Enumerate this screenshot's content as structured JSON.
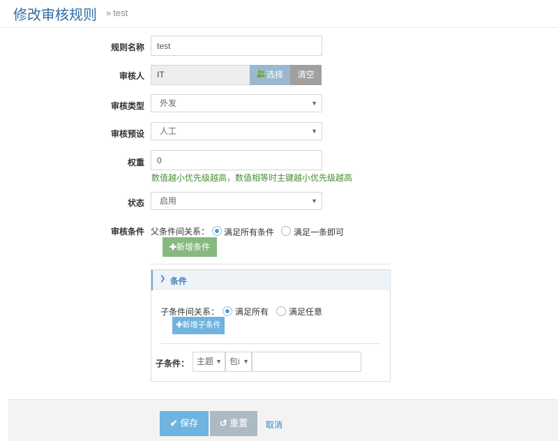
{
  "header": {
    "title": "修改审核规则",
    "breadcrumb_sep": "»",
    "breadcrumb": "test"
  },
  "form": {
    "rule_name": {
      "label": "规则名称",
      "value": "test"
    },
    "reviewer": {
      "label": "审核人",
      "value": "IT",
      "choose_label": "选择",
      "clear_label": "清空"
    },
    "review_type": {
      "label": "审核类型",
      "value": "外发"
    },
    "review_preset": {
      "label": "审核预设",
      "value": "人工"
    },
    "weight": {
      "label": "权重",
      "value": "0",
      "hint": "数值越小优先级越高，数值相等时主键越小优先级越高"
    },
    "status": {
      "label": "状态",
      "value": "启用"
    },
    "conditions": {
      "label": "审核条件",
      "parent_relation_label": "父条件间关系：",
      "parent_option_all": "满足所有条件",
      "parent_option_any": "满足一条即可",
      "add_condition_label": "新增条件",
      "panel_title": "条件",
      "child_relation_label": "子条件间关系：",
      "child_option_all": "满足所有",
      "child_option_any": "满足任意",
      "add_child_label": "新增子条件",
      "child_condition_label": "子条件：",
      "child_field_select": "主题",
      "child_op_select": "包i",
      "child_value": ""
    }
  },
  "footer": {
    "save_label": "保存",
    "reset_label": "重置",
    "cancel_label": "取消"
  },
  "colors": {
    "title_blue": "#2e6da4",
    "hint_green": "#478d35",
    "save_blue": "#6fb3e0",
    "add_green": "#87b87f"
  }
}
